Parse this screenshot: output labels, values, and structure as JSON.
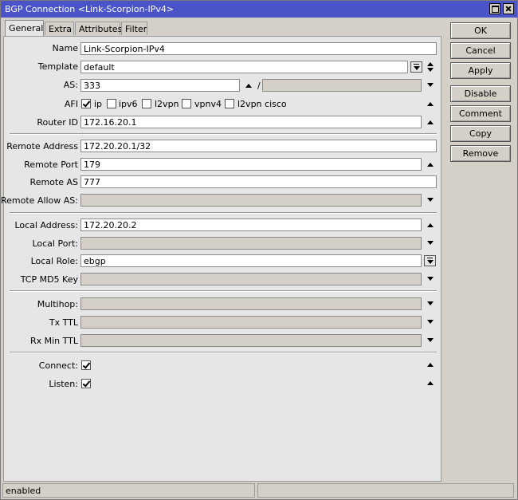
{
  "window": {
    "title": "BGP Connection <Link-Scorpion-IPv4>"
  },
  "tabs": [
    {
      "label": "General"
    },
    {
      "label": "Extra"
    },
    {
      "label": "Attributes"
    },
    {
      "label": "Filter"
    }
  ],
  "form": {
    "name": {
      "label": "Name",
      "value": "Link-Scorpion-IPv4"
    },
    "template": {
      "label": "Template",
      "value": "default"
    },
    "as": {
      "label": "AS:",
      "value": "333",
      "separator": "/",
      "value2": ""
    },
    "afi": {
      "label": "AFI",
      "options": [
        {
          "label": "ip",
          "checked": true
        },
        {
          "label": "ipv6",
          "checked": false
        },
        {
          "label": "l2vpn",
          "checked": false
        },
        {
          "label": "vpnv4",
          "checked": false
        },
        {
          "label": "l2vpn cisco",
          "checked": false
        }
      ]
    },
    "router_id": {
      "label": "Router ID",
      "value": "172.16.20.1"
    },
    "remote_address": {
      "label": "Remote Address",
      "value": "172.20.20.1/32"
    },
    "remote_port": {
      "label": "Remote Port",
      "value": "179"
    },
    "remote_as": {
      "label": "Remote AS",
      "value": "777"
    },
    "remote_allow_as": {
      "label": "Remote Allow AS:",
      "value": ""
    },
    "local_address": {
      "label": "Local Address:",
      "value": "172.20.20.2"
    },
    "local_port": {
      "label": "Local Port:",
      "value": ""
    },
    "local_role": {
      "label": "Local Role:",
      "value": "ebgp"
    },
    "tcp_md5_key": {
      "label": "TCP MD5 Key",
      "value": ""
    },
    "multihop": {
      "label": "Multihop:",
      "value": ""
    },
    "tx_ttl": {
      "label": "Tx TTL",
      "value": ""
    },
    "rx_min_ttl": {
      "label": "Rx Min TTL",
      "value": ""
    },
    "connect": {
      "label": "Connect:",
      "checked": true
    },
    "listen": {
      "label": "Listen:",
      "checked": true
    }
  },
  "buttons": {
    "ok": "OK",
    "cancel": "Cancel",
    "apply": "Apply",
    "disable": "Disable",
    "comment": "Comment",
    "copy": "Copy",
    "remove": "Remove"
  },
  "status": {
    "left": "enabled",
    "right": ""
  },
  "colors": {
    "titlebar": "#4a54c8",
    "panel": "#e6e6e6",
    "window": "#d4d0c8"
  }
}
